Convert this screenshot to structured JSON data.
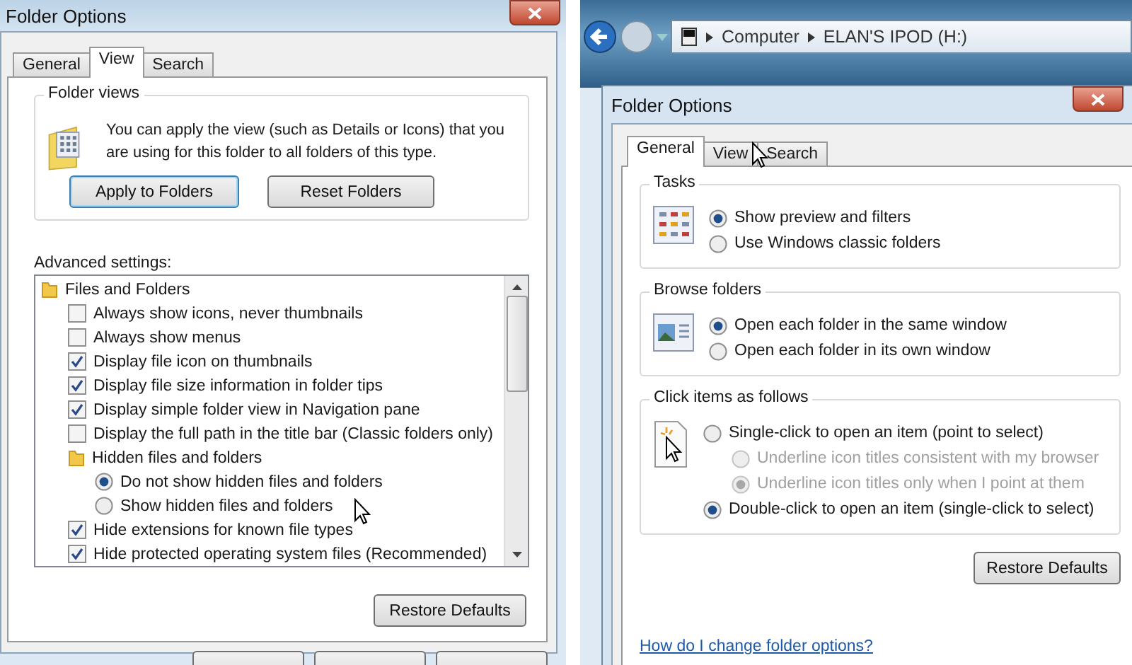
{
  "left_dialog": {
    "title": "Folder Options",
    "tabs": [
      {
        "label": "General",
        "selected": false
      },
      {
        "label": "View",
        "selected": true
      },
      {
        "label": "Search",
        "selected": false
      }
    ],
    "folder_views": {
      "label": "Folder views",
      "description": "You can apply the view (such as Details or Icons) that you are using for this folder to all folders of this type.",
      "buttons": [
        {
          "label": "Apply to Folders",
          "focused": true
        },
        {
          "label": "Reset Folders",
          "focused": false
        }
      ]
    },
    "advanced_settings": {
      "label": "Advanced settings:",
      "items": [
        {
          "kind": "folder",
          "label": "Files and Folders",
          "children": [
            {
              "kind": "checkbox",
              "label": "Always show icons, never thumbnails",
              "checked": false
            },
            {
              "kind": "checkbox",
              "label": "Always show menus",
              "checked": false
            },
            {
              "kind": "checkbox",
              "label": "Display file icon on thumbnails",
              "checked": true
            },
            {
              "kind": "checkbox",
              "label": "Display file size information in folder tips",
              "checked": true
            },
            {
              "kind": "checkbox",
              "label": "Display simple folder view in Navigation pane",
              "checked": true
            },
            {
              "kind": "checkbox",
              "label": "Display the full path in the title bar (Classic folders only)",
              "checked": false
            },
            {
              "kind": "folder",
              "label": "Hidden files and folders",
              "children": [
                {
                  "kind": "radio",
                  "label": "Do not show hidden files and folders",
                  "selected": true
                },
                {
                  "kind": "radio",
                  "label": "Show hidden files and folders",
                  "selected": false
                }
              ]
            },
            {
              "kind": "checkbox",
              "label": "Hide extensions for known file types",
              "checked": true
            },
            {
              "kind": "checkbox",
              "label": "Hide protected operating system files (Recommended)",
              "checked": true
            }
          ]
        }
      ]
    },
    "restore_button": "Restore Defaults"
  },
  "explorer": {
    "breadcrumbs": [
      "Computer",
      "ELAN'S IPOD (H:)"
    ]
  },
  "right_dialog": {
    "title": "Folder Options",
    "tabs": [
      {
        "label": "General",
        "selected": true
      },
      {
        "label": "View",
        "selected": false
      },
      {
        "label": "Search",
        "selected": false
      }
    ],
    "groups": [
      {
        "label": "Tasks",
        "options": [
          {
            "label": "Show preview and filters",
            "selected": true,
            "disabled": false
          },
          {
            "label": "Use Windows classic folders",
            "selected": false,
            "disabled": false
          }
        ]
      },
      {
        "label": "Browse folders",
        "options": [
          {
            "label": "Open each folder in the same window",
            "selected": true,
            "disabled": false
          },
          {
            "label": "Open each folder in its own window",
            "selected": false,
            "disabled": false
          }
        ]
      },
      {
        "label": "Click items as follows",
        "options": [
          {
            "label": "Single-click to open an item (point to select)",
            "selected": false,
            "disabled": false,
            "children": [
              {
                "label": "Underline icon titles consistent with my browser",
                "selected": false,
                "disabled": true
              },
              {
                "label": "Underline icon titles only when I point at them",
                "selected": true,
                "disabled": true
              }
            ]
          },
          {
            "label": "Double-click to open an item (single-click to select)",
            "selected": true,
            "disabled": false
          }
        ]
      }
    ],
    "restore_button": "Restore Defaults",
    "help_link": "How do I change folder options?"
  }
}
